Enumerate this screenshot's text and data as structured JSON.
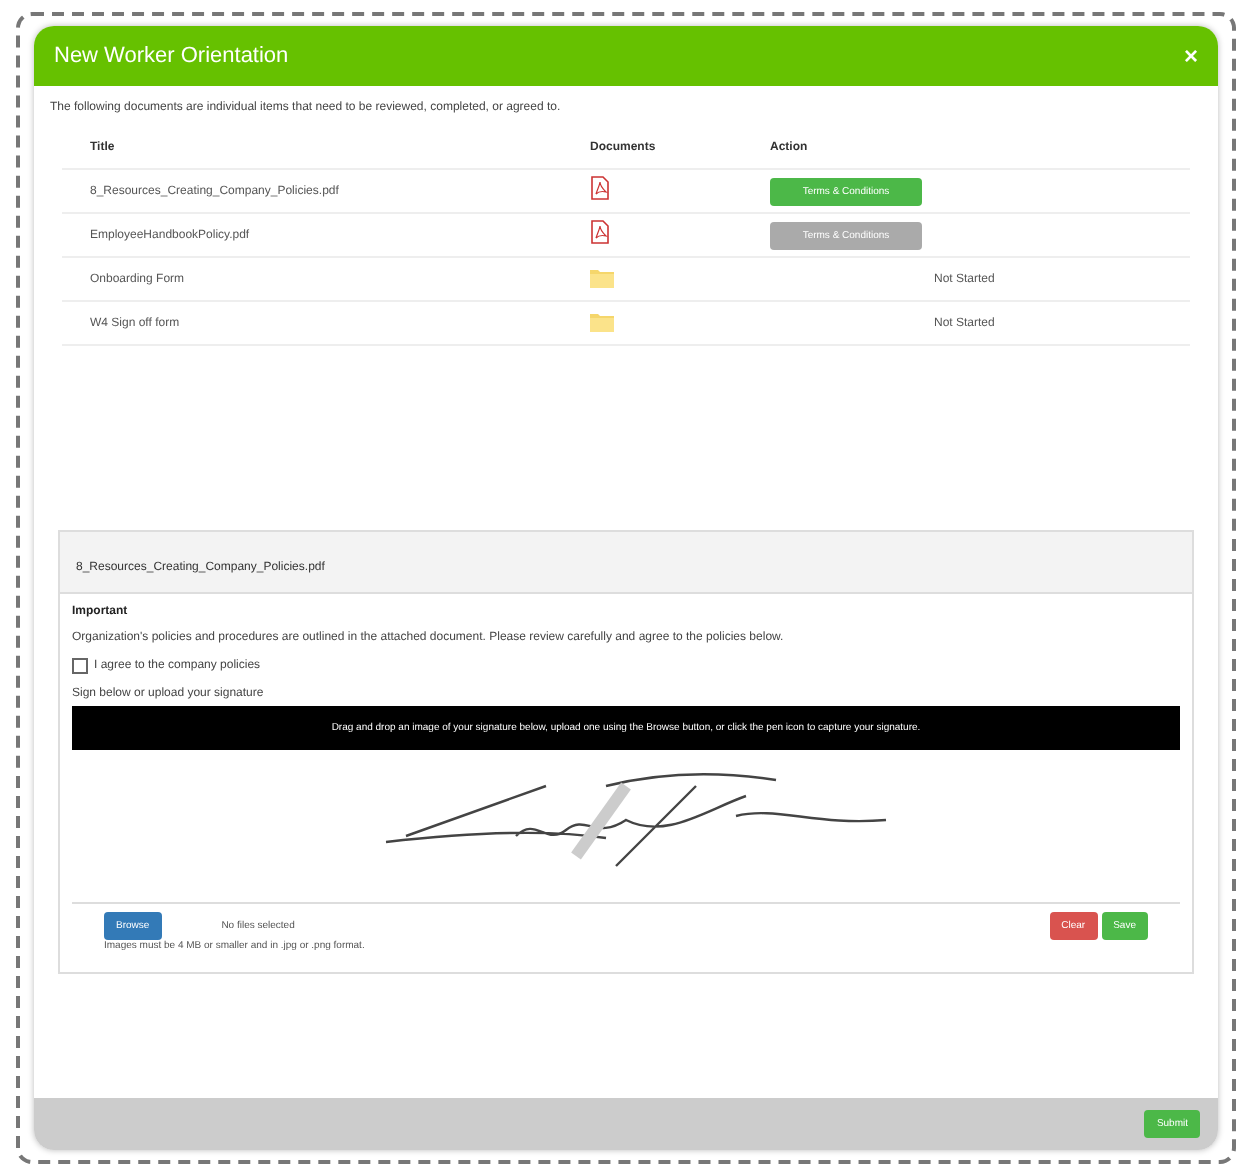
{
  "window": {
    "title": "New Worker Orientation",
    "close": "×"
  },
  "intro": "The following documents are individual items that need to be reviewed, completed, or agreed to.",
  "table": {
    "columns": [
      "Title",
      "Documents",
      "Action"
    ],
    "rows": [
      {
        "title": "8_Resources_Creating_Company_Policies.pdf",
        "kind": "pdf",
        "action": {
          "kind": "button",
          "label": "Terms & Conditions",
          "disabled": false
        }
      },
      {
        "title": "EmployeeHandbookPolicy.pdf",
        "kind": "pdf",
        "action": {
          "kind": "button",
          "label": "Terms & Conditions",
          "disabled": true
        }
      },
      {
        "title": "Onboarding Form",
        "kind": "form",
        "action": {
          "kind": "status",
          "label": "Not Started"
        }
      },
      {
        "title": "W4 Sign off form",
        "kind": "form",
        "action": {
          "kind": "status",
          "label": "Not Started"
        }
      }
    ]
  },
  "panel": {
    "title": "8_Resources_Creating_Company_Policies.pdf",
    "heading": "Important",
    "text": "Organization's policies and procedures are outlined in the attached document. Please review carefully and agree to the policies below.",
    "agree": {
      "label": "I agree to the company policies",
      "checked": false
    },
    "sign_label": "Sign below or upload your signature",
    "banner": "Drag and drop an image of your signature below, upload one using the Browse button, or click the pen icon to capture your signature.",
    "browse": "Browse",
    "file_status": "No files selected",
    "clear": "Clear",
    "save": "Save",
    "hint": "Images must be 4 MB or smaller and in .jpg or .png format."
  },
  "footer": {
    "submit": "Submit"
  }
}
